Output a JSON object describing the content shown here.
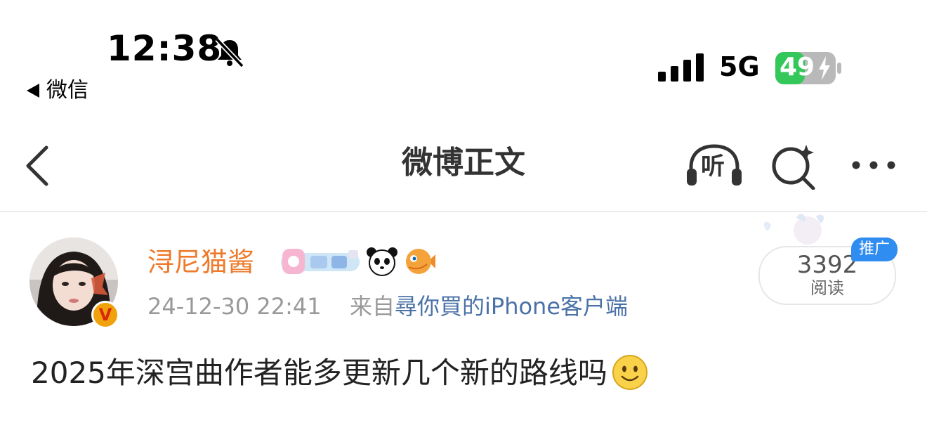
{
  "status_bar": {
    "time": "12:38",
    "bell_icon": "bell-slash-icon",
    "back_app": "微信",
    "network": "5G",
    "battery_level": "49",
    "battery_percent": 49
  },
  "nav": {
    "title": "微博正文",
    "listen_label": "听"
  },
  "post": {
    "username": "浔尼猫酱",
    "verified_badge": "V",
    "timestamp": "24-12-30 22:41",
    "source_prefix": "来自",
    "source": "尋你買的iPhone客户端",
    "read_count": "3392",
    "read_label": "阅读",
    "promo_tag": "推广",
    "content": "2025年深宫曲作者能多更新几个新的路线吗"
  },
  "colors": {
    "username": "#ee7a2b",
    "source_link": "#4b72a7",
    "battery_green": "#34c759",
    "promo": "#2f8cf0",
    "verified": "#f0a20d"
  }
}
